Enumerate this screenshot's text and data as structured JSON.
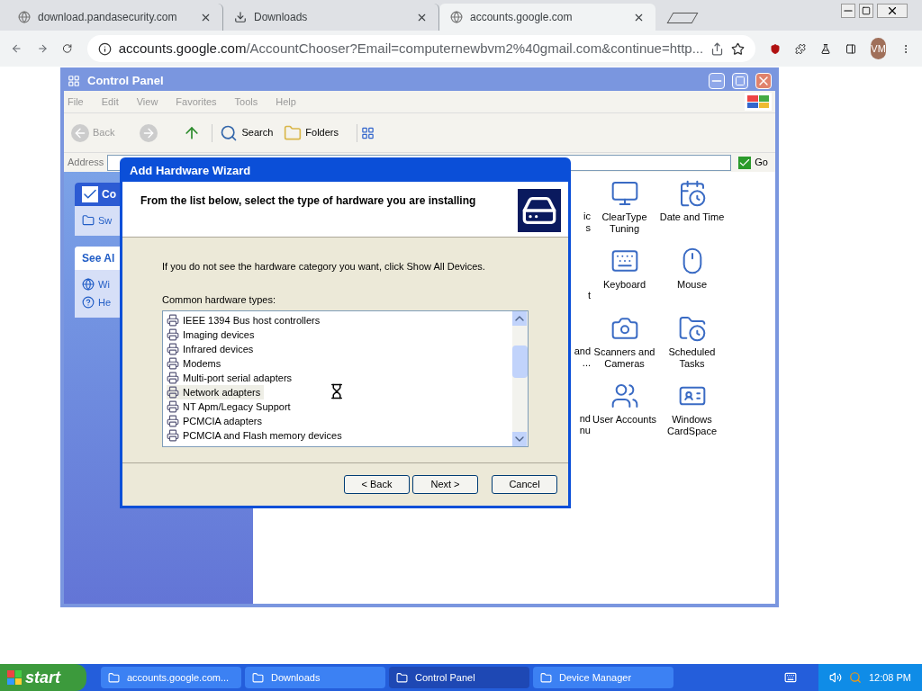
{
  "browser": {
    "tabs": [
      {
        "title": "download.pandasecurity.com",
        "selected": false,
        "kind": "globe"
      },
      {
        "title": "Downloads",
        "selected": false,
        "kind": "download"
      },
      {
        "title": "accounts.google.com",
        "selected": true,
        "kind": "globe"
      }
    ],
    "url_host": "accounts.google.com",
    "url_path": "/AccountChooser?Email=computernewbvm2%40gmail.com&continue=http...",
    "profile": "VM"
  },
  "control_panel": {
    "title": "Control Panel",
    "menu": [
      "File",
      "Edit",
      "View",
      "Favorites",
      "Tools",
      "Help"
    ],
    "toolbar": {
      "back": "Back",
      "search": "Search",
      "folders": "Folders"
    },
    "address_label": "Address",
    "go": "Go",
    "left_pane": [
      {
        "heading": "Co",
        "links": [
          "Sw"
        ]
      },
      {
        "heading": "See Al",
        "links": [
          "Wi",
          "He"
        ]
      }
    ],
    "partial_labels": [
      [
        "ic",
        "s"
      ],
      [
        "t"
      ],
      [
        "and",
        "..."
      ],
      [
        "nd",
        "nu"
      ]
    ],
    "items": [
      {
        "label": "ClearType Tuning"
      },
      {
        "label": "Date and Time"
      },
      {
        "label": "Keyboard"
      },
      {
        "label": "Mouse"
      },
      {
        "label": "Scanners and Cameras"
      },
      {
        "label": "Scheduled Tasks"
      },
      {
        "label": "User Accounts"
      },
      {
        "label": "Windows CardSpace"
      }
    ]
  },
  "wizard": {
    "title": "Add Hardware Wizard",
    "header": "From the list below, select the type of hardware you are installing",
    "hint": "If you do not see the hardware category you want, click Show All Devices.",
    "list_label": "Common hardware types:",
    "items": [
      {
        "label": "IEEE 1394 Bus host controllers",
        "selected": false
      },
      {
        "label": "Imaging devices",
        "selected": false
      },
      {
        "label": "Infrared devices",
        "selected": false
      },
      {
        "label": "Modems",
        "selected": false
      },
      {
        "label": "Multi-port serial adapters",
        "selected": false
      },
      {
        "label": "Network adapters",
        "selected": true
      },
      {
        "label": "NT Apm/Legacy Support",
        "selected": false
      },
      {
        "label": "PCMCIA adapters",
        "selected": false
      },
      {
        "label": "PCMCIA and Flash memory devices",
        "selected": false
      }
    ],
    "buttons": [
      "< Back",
      "Next >",
      "Cancel"
    ]
  },
  "taskbar": {
    "start": "start",
    "tasks": [
      {
        "label": "accounts.google.com...",
        "selected": false
      },
      {
        "label": "Downloads",
        "selected": false
      },
      {
        "label": "Control Panel",
        "selected": true
      },
      {
        "label": "Device Manager",
        "selected": false
      }
    ],
    "clock": "12:08 PM"
  }
}
